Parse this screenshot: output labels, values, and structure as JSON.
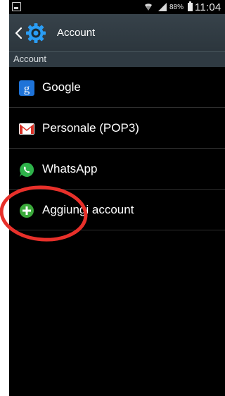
{
  "status_bar": {
    "battery_percent": "88%",
    "clock": "11:04"
  },
  "action_bar": {
    "title": "Account"
  },
  "section": {
    "header": "Account"
  },
  "accounts": [
    {
      "label": "Google",
      "icon": "google-icon"
    },
    {
      "label": "Personale (POP3)",
      "icon": "gmail-icon"
    },
    {
      "label": "WhatsApp",
      "icon": "whatsapp-icon"
    },
    {
      "label": "Aggiungi account",
      "icon": "add-icon"
    }
  ],
  "colors": {
    "background": "#000000",
    "action_bar": "#37424a",
    "accent_blue": "#2a9df4",
    "google_blue": "#1e73d8",
    "gmail_red": "#d93025",
    "whatsapp_green": "#2eb24a",
    "add_green": "#3aa93a",
    "annotation_red": "#e8302a"
  }
}
